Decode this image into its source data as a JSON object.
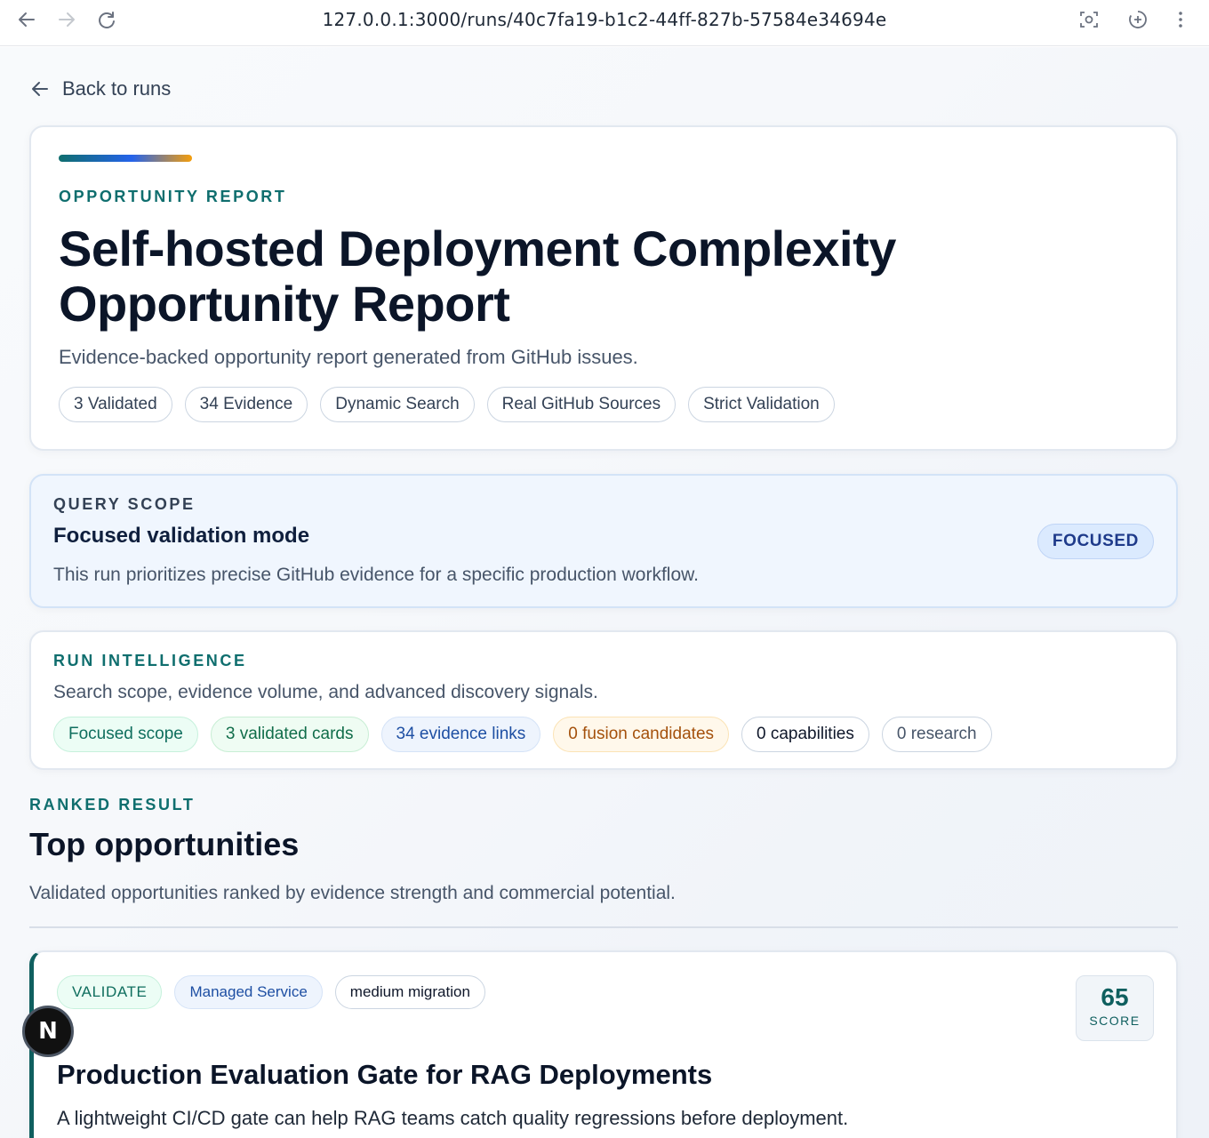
{
  "browser": {
    "url": "127.0.0.1:3000/runs/40c7fa19-b1c2-44ff-827b-57584e34694e",
    "back_icon": "arrow-left-icon",
    "forward_icon": "arrow-right-icon",
    "reload_icon": "reload-icon"
  },
  "back_link": {
    "label": "Back to runs"
  },
  "report": {
    "eyebrow": "OPPORTUNITY REPORT",
    "title": "Self-hosted Deployment Complexity Opportunity Report",
    "subtitle": "Evidence-backed opportunity report generated from GitHub issues.",
    "pills": [
      "3 Validated",
      "34 Evidence",
      "Dynamic Search",
      "Real GitHub Sources",
      "Strict Validation"
    ]
  },
  "scope": {
    "eyebrow": "QUERY SCOPE",
    "title": "Focused validation mode",
    "description": "This run prioritizes precise GitHub evidence for a specific production workflow.",
    "badge": "FOCUSED"
  },
  "intelligence": {
    "eyebrow": "RUN INTELLIGENCE",
    "description": "Search scope, evidence volume, and advanced discovery signals.",
    "tags": [
      "Focused scope",
      "3 validated cards",
      "34 evidence links",
      "0 fusion candidates",
      "0 capabilities",
      "0 research"
    ]
  },
  "ranked": {
    "eyebrow": "RANKED RESULT",
    "title": "Top opportunities",
    "subtitle": "Validated opportunities ranked by evidence strength and commercial potential."
  },
  "opportunity": {
    "tags": [
      "VALIDATE",
      "Managed Service",
      "medium migration"
    ],
    "score": "65",
    "score_label": "SCORE",
    "title": "Production Evaluation Gate for RAG Deployments",
    "description": "A lightweight CI/CD gate can help RAG teams catch quality regressions before deployment."
  },
  "fab": {
    "label": "N"
  }
}
